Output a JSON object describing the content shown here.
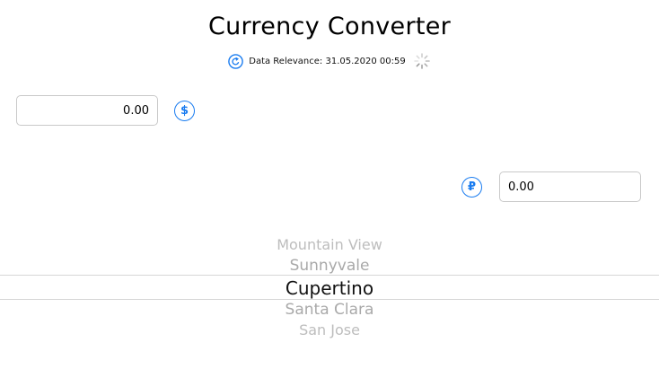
{
  "app": {
    "title": "Currency Converter"
  },
  "relevance": {
    "label": "Data Relevance: 31.05.2020 00:59",
    "icon": "refresh-icon",
    "loading_icon": "spinner-icon"
  },
  "converter": {
    "from": {
      "value": "0.00",
      "currency_symbol": "$",
      "icon": "dollar-icon"
    },
    "to": {
      "value": "0.00",
      "currency_symbol": "₽",
      "icon": "ruble-icon"
    }
  },
  "picker": {
    "items": [
      "Mountain View",
      "Sunnyvale",
      "Cupertino",
      "Santa Clara",
      "San Jose"
    ],
    "selected": "Cupertino"
  },
  "colors": {
    "accent": "#1a7cf0",
    "text": "#000000",
    "picker_dim": "#a9a9a9",
    "divider": "#d6d6d6"
  }
}
